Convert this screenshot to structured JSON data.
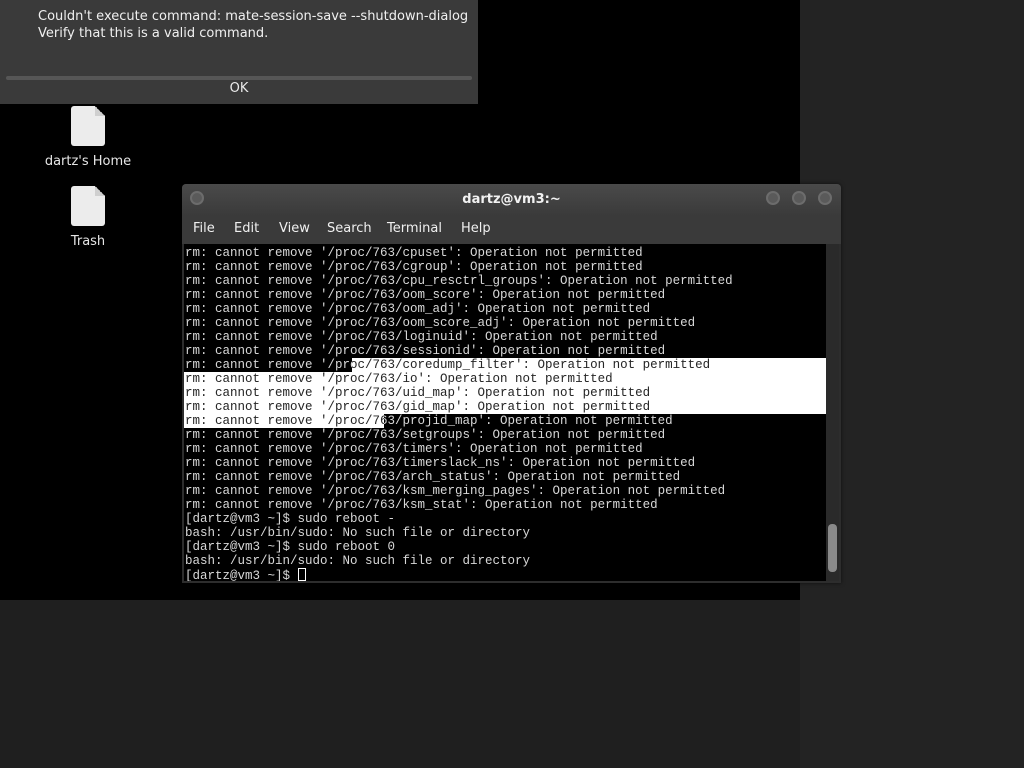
{
  "dialog": {
    "line1": "Couldn't execute command: mate-session-save --shutdown-dialog",
    "line2": "Verify that this is a valid command.",
    "ok_label": "OK"
  },
  "desktop": {
    "icons": [
      {
        "label": "dartz's Home",
        "icon": "home-folder-icon"
      },
      {
        "label": "Trash",
        "icon": "trash-icon"
      }
    ]
  },
  "terminal": {
    "title": "dartz@vm3:~",
    "menu": [
      "File",
      "Edit",
      "View",
      "Search",
      "Terminal",
      "Help"
    ],
    "lines": [
      "rm: cannot remove '/proc/763/cpuset': Operation not permitted",
      "rm: cannot remove '/proc/763/cgroup': Operation not permitted",
      "rm: cannot remove '/proc/763/cpu_resctrl_groups': Operation not permitted",
      "rm: cannot remove '/proc/763/oom_score': Operation not permitted",
      "rm: cannot remove '/proc/763/oom_adj': Operation not permitted",
      "rm: cannot remove '/proc/763/oom_score_adj': Operation not permitted",
      "rm: cannot remove '/proc/763/loginuid': Operation not permitted",
      "rm: cannot remove '/proc/763/sessionid': Operation not permitted",
      "rm: cannot remove '/proc/763/coredump_filter': Operation not permitted",
      "rm: cannot remove '/proc/763/io': Operation not permitted",
      "rm: cannot remove '/proc/763/uid_map': Operation not permitted",
      "rm: cannot remove '/proc/763/gid_map': Operation not permitted",
      "rm: cannot remove '/proc/763/projid_map': Operation not permitted",
      "rm: cannot remove '/proc/763/setgroups': Operation not permitted",
      "rm: cannot remove '/proc/763/timers': Operation not permitted",
      "rm: cannot remove '/proc/763/timerslack_ns': Operation not permitted",
      "rm: cannot remove '/proc/763/arch_status': Operation not permitted",
      "rm: cannot remove '/proc/763/ksm_merging_pages': Operation not permitted",
      "rm: cannot remove '/proc/763/ksm_stat': Operation not permitted",
      "[dartz@vm3 ~]$ sudo reboot -",
      "bash: /usr/bin/sudo: No such file or directory",
      "[dartz@vm3 ~]$ sudo reboot 0",
      "bash: /usr/bin/sudo: No such file or directory",
      "[dartz@vm3 ~]$ "
    ]
  },
  "colors": {
    "desktop": "#000000",
    "dialog_bg": "#3a3a3a",
    "terminal_bg": "#000000",
    "selection": "#ffffff"
  }
}
